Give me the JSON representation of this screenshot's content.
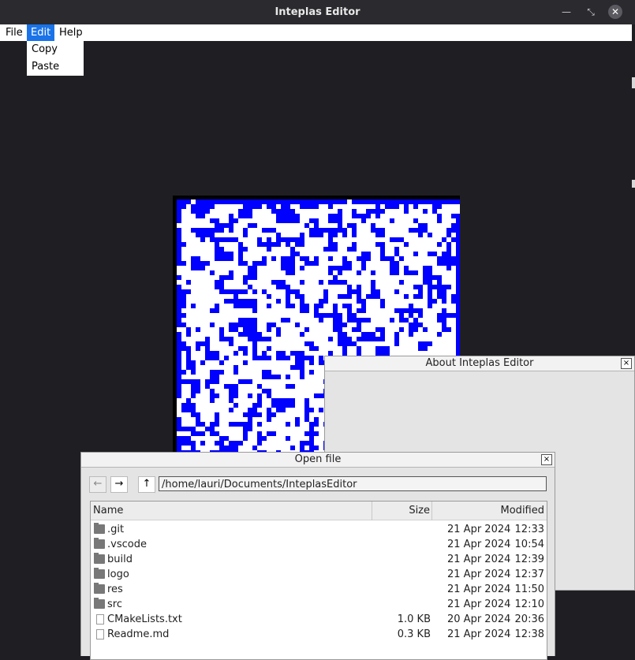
{
  "window": {
    "title": "Inteplas Editor"
  },
  "menubar": {
    "file": "File",
    "edit": "Edit",
    "help": "Help"
  },
  "edit_menu": {
    "items": [
      "Copy",
      "Paste"
    ]
  },
  "colors": {
    "accent": "#1a73e8",
    "pixel_blue": "#0000ff",
    "pixel_white": "#ffffff"
  },
  "about_dialog": {
    "title": "About Inteplas Editor",
    "close_label": "×"
  },
  "open_file_dialog": {
    "title": "Open file",
    "close_label": "×",
    "back_label": "←",
    "forward_label": "→",
    "up_label": "↑",
    "path": "/home/lauri/Documents/InteplasEditor",
    "columns": {
      "name": "Name",
      "size": "Size",
      "modified": "Modified"
    },
    "entries": [
      {
        "type": "folder",
        "name": ".git",
        "size": "",
        "date": "21 Apr 2024",
        "time": "12:33"
      },
      {
        "type": "folder",
        "name": ".vscode",
        "size": "",
        "date": "21 Apr 2024",
        "time": "10:54"
      },
      {
        "type": "folder",
        "name": "build",
        "size": "",
        "date": "21 Apr 2024",
        "time": "12:39"
      },
      {
        "type": "folder",
        "name": "logo",
        "size": "",
        "date": "21 Apr 2024",
        "time": "12:37"
      },
      {
        "type": "folder",
        "name": "res",
        "size": "",
        "date": "21 Apr 2024",
        "time": "11:50"
      },
      {
        "type": "folder",
        "name": "src",
        "size": "",
        "date": "21 Apr 2024",
        "time": "12:10"
      },
      {
        "type": "file",
        "name": "CMakeLists.txt",
        "size": "1.0 KB",
        "date": "20 Apr 2024",
        "time": "20:36"
      },
      {
        "type": "file",
        "name": "Readme.md",
        "size": "0.3 KB",
        "date": "21 Apr 2024",
        "time": "12:38"
      }
    ]
  }
}
